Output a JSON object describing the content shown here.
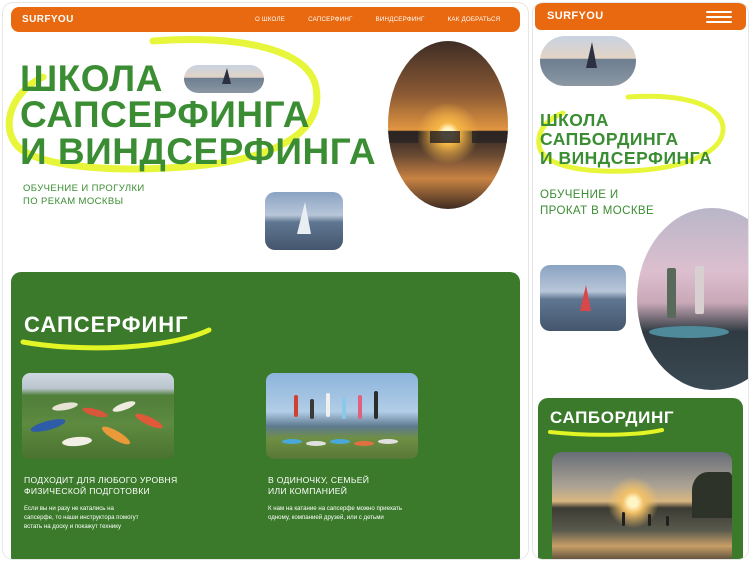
{
  "brand": "SURFYOU",
  "nav": [
    "О ШКОЛЕ",
    "САПСЕРФИНГ",
    "ВИНДСЕРФИНГ",
    "КАК ДОБРАТЬСЯ"
  ],
  "desktop": {
    "hero_title": [
      "ШКОЛА",
      "САПСЕРФИНГА",
      "И ВИНДСЕРФИНГА"
    ],
    "hero_subtitle": [
      "ОБУЧЕНИЕ И ПРОГУЛКИ",
      "ПО РЕКАМ МОСКВЫ"
    ],
    "section_title": "САПСЕРФИНГ",
    "cards": [
      {
        "heading": [
          "ПОДХОДИТ ДЛЯ ЛЮБОГО УРОВНЯ",
          "ФИЗИЧЕСКОЙ ПОДГОТОВКИ"
        ],
        "text": [
          "Если вы ни разу не катались на",
          "сапсерфе, то наши инструктора помогут",
          "встать на доску и покажут технику"
        ]
      },
      {
        "heading": [
          "В ОДИНОЧКУ, СЕМЬЕЙ",
          "ИЛИ КОМПАНИЕЙ"
        ],
        "text": [
          "К нам на катание на сапсерфе можно приехать",
          "одному, компанией друзей, или с детьми"
        ]
      }
    ]
  },
  "mobile": {
    "hero_title": [
      "ШКОЛА",
      "САПБОРДИНГА",
      "И ВИНДСЕРФИНГА"
    ],
    "hero_subtitle": [
      "ОБУЧЕНИЕ И",
      "ПРОКАТ В МОСКВЕ"
    ],
    "section_title": "САПБОРДИНГ"
  },
  "colors": {
    "accent_orange": "#e8690f",
    "brand_green": "#3a8d32",
    "section_green": "#3a7a2a",
    "highlighter": "#e4f526"
  },
  "icons": [
    "menu-icon"
  ]
}
